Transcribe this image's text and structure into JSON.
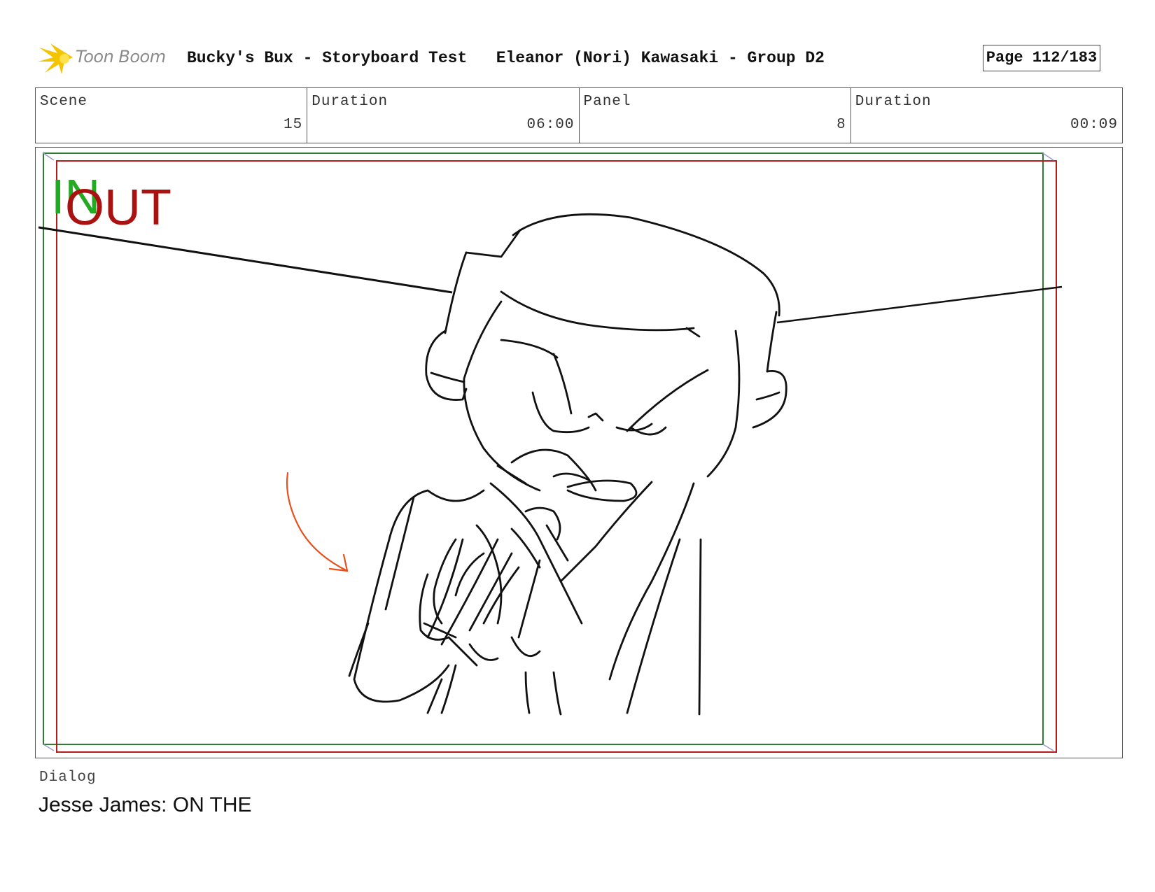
{
  "header": {
    "logo_text": "Toon Boom",
    "project_title": "Bucky's Bux - Storyboard Test",
    "author": "Eleanor (Nori) Kawasaki - Group D2",
    "page": "Page 112/183"
  },
  "info": {
    "scene_label": "Scene",
    "scene_value": "15",
    "scene_duration_label": "Duration",
    "scene_duration_value": "06:00",
    "panel_label": "Panel",
    "panel_value": "8",
    "panel_duration_label": "Duration",
    "panel_duration_value": "00:09"
  },
  "panel": {
    "in_marker": "IN",
    "out_marker": "OUT",
    "colors": {
      "in_frame": "#2e7d32",
      "out_frame": "#b71c1c",
      "in_text": "#22aa22",
      "out_text": "#aa1111",
      "arrow": "#e8501e"
    }
  },
  "dialog": {
    "label": "Dialog",
    "text": "Jesse James: ON THE"
  }
}
